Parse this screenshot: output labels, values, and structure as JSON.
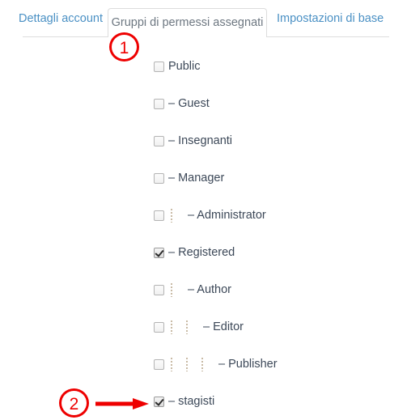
{
  "tabs": [
    {
      "label": "Dettagli account",
      "active": false
    },
    {
      "label": "Gruppi di permessi assegnati",
      "active": true
    },
    {
      "label": "Impostazioni di base",
      "active": false
    }
  ],
  "permission_groups": [
    {
      "label": "Public",
      "checked": false,
      "depth": 0,
      "indent_bars": 0
    },
    {
      "label": "– Guest",
      "checked": false,
      "depth": 0,
      "indent_bars": 0
    },
    {
      "label": "– Insegnanti",
      "checked": false,
      "depth": 0,
      "indent_bars": 0
    },
    {
      "label": "– Manager",
      "checked": false,
      "depth": 0,
      "indent_bars": 0
    },
    {
      "label": "– Administrator",
      "checked": false,
      "depth": 1,
      "indent_bars": 1
    },
    {
      "label": "– Registered",
      "checked": true,
      "depth": 0,
      "indent_bars": 0
    },
    {
      "label": "– Author",
      "checked": false,
      "depth": 1,
      "indent_bars": 1
    },
    {
      "label": "– Editor",
      "checked": false,
      "depth": 2,
      "indent_bars": 2
    },
    {
      "label": "– Publisher",
      "checked": false,
      "depth": 3,
      "indent_bars": 3
    },
    {
      "label": "– stagisti",
      "checked": true,
      "depth": 0,
      "indent_bars": 0
    }
  ],
  "annotations": {
    "marker_1": "1",
    "marker_2": "2",
    "color": "#ee0000"
  },
  "colors": {
    "tab_link": "#4a90c4",
    "tab_active_text": "#6d7781",
    "list_text": "#3c4858",
    "border": "#dddddd",
    "annotation_red": "#ee0000"
  }
}
